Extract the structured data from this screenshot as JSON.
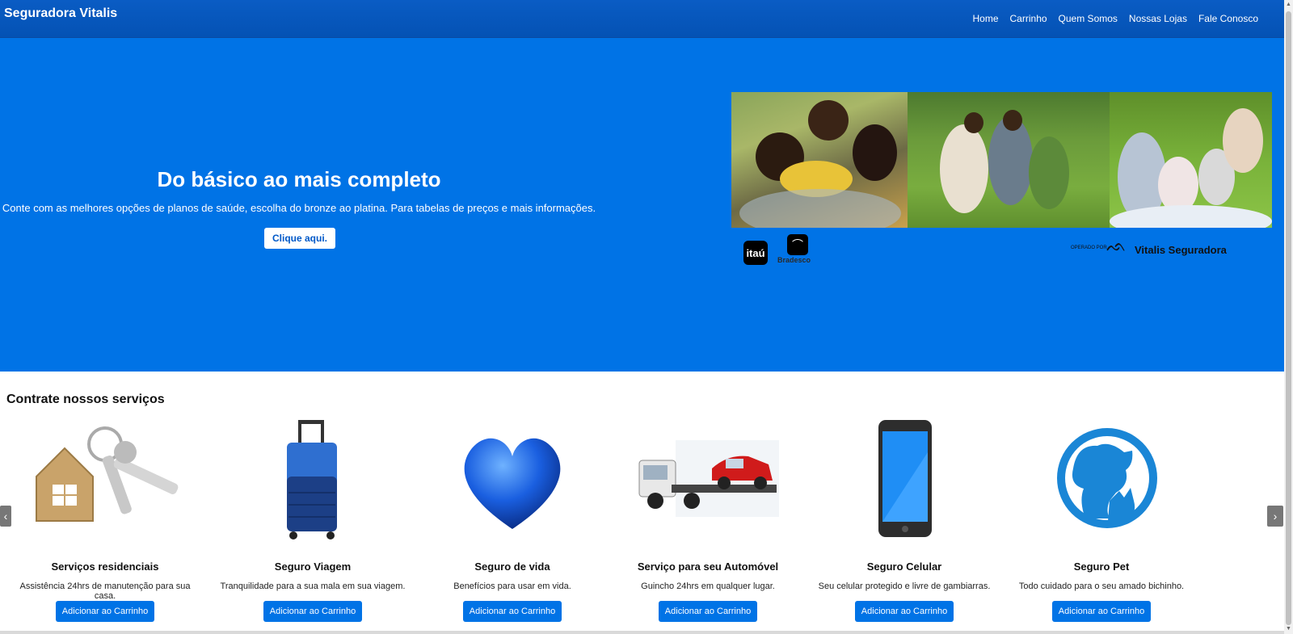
{
  "header": {
    "brand": "Seguradora Vitalis",
    "nav": [
      "Home",
      "Carrinho",
      "Quem Somos",
      "Nossas Lojas",
      "Fale Conosco"
    ]
  },
  "hero": {
    "title": "Do básico ao mais completo",
    "subtitle": "Conte com as melhores opções de planos de saúde, escolha do bronze ao platina. Para tabelas de preços e mais informações.",
    "button": "Clique aqui.",
    "logos": {
      "itau": "itaú",
      "bradesco": "Bradesco",
      "operado": "OPERADO POR",
      "vitalis": "Vitalis Seguradora"
    }
  },
  "services": {
    "title": "Contrate nossos serviços",
    "prev": "‹",
    "next": "›",
    "items": [
      {
        "title": "Serviços residenciais",
        "desc": "Assistência 24hrs de manutenção para sua casa.",
        "button": "Adicionar ao Carrinho",
        "icon": "house-keys-icon"
      },
      {
        "title": "Seguro Viagem",
        "desc": "Tranquilidade para a sua mala em sua viagem.",
        "button": "Adicionar ao Carrinho",
        "icon": "suitcase-icon"
      },
      {
        "title": "Seguro de vida",
        "desc": "Benefícios para usar em vida.",
        "button": "Adicionar ao Carrinho",
        "icon": "heart-icon"
      },
      {
        "title": "Serviço para seu Automóvel",
        "desc": "Guincho 24hrs em qualquer lugar.",
        "button": "Adicionar ao Carrinho",
        "icon": "tow-truck-icon"
      },
      {
        "title": "Seguro Celular",
        "desc": "Seu celular protegido e livre de gambiarras.",
        "button": "Adicionar ao Carrinho",
        "icon": "smartphone-icon"
      },
      {
        "title": "Seguro Pet",
        "desc": "Todo cuidado para o seu amado bichinho.",
        "button": "Adicionar ao Carrinho",
        "icon": "pet-icon"
      }
    ]
  },
  "colors": {
    "header": "#0452b4",
    "hero": "#0073e6",
    "button": "#0073e6"
  }
}
